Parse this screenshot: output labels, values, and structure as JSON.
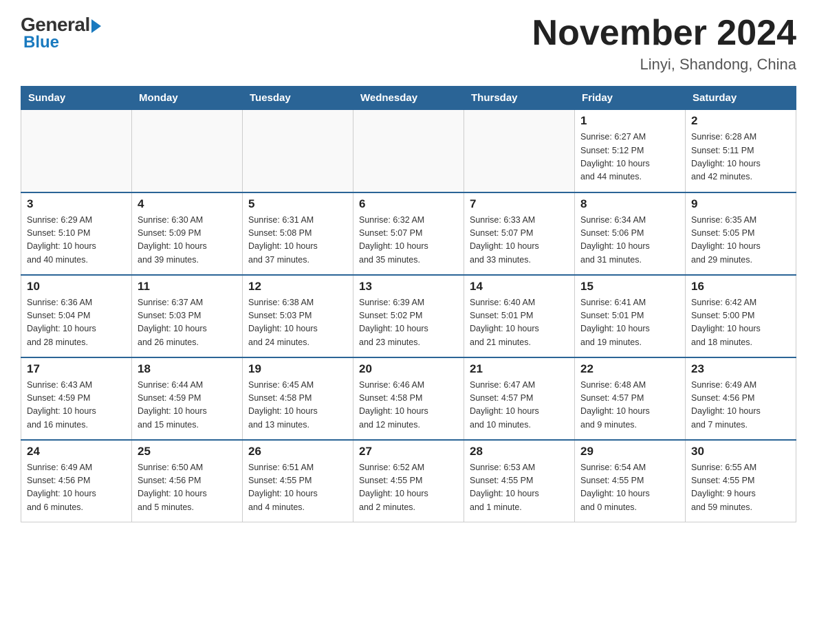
{
  "header": {
    "logo_general": "General",
    "logo_blue": "Blue",
    "title": "November 2024",
    "subtitle": "Linyi, Shandong, China"
  },
  "days_of_week": [
    "Sunday",
    "Monday",
    "Tuesday",
    "Wednesday",
    "Thursday",
    "Friday",
    "Saturday"
  ],
  "weeks": [
    [
      {
        "day": "",
        "info": ""
      },
      {
        "day": "",
        "info": ""
      },
      {
        "day": "",
        "info": ""
      },
      {
        "day": "",
        "info": ""
      },
      {
        "day": "",
        "info": ""
      },
      {
        "day": "1",
        "info": "Sunrise: 6:27 AM\nSunset: 5:12 PM\nDaylight: 10 hours\nand 44 minutes."
      },
      {
        "day": "2",
        "info": "Sunrise: 6:28 AM\nSunset: 5:11 PM\nDaylight: 10 hours\nand 42 minutes."
      }
    ],
    [
      {
        "day": "3",
        "info": "Sunrise: 6:29 AM\nSunset: 5:10 PM\nDaylight: 10 hours\nand 40 minutes."
      },
      {
        "day": "4",
        "info": "Sunrise: 6:30 AM\nSunset: 5:09 PM\nDaylight: 10 hours\nand 39 minutes."
      },
      {
        "day": "5",
        "info": "Sunrise: 6:31 AM\nSunset: 5:08 PM\nDaylight: 10 hours\nand 37 minutes."
      },
      {
        "day": "6",
        "info": "Sunrise: 6:32 AM\nSunset: 5:07 PM\nDaylight: 10 hours\nand 35 minutes."
      },
      {
        "day": "7",
        "info": "Sunrise: 6:33 AM\nSunset: 5:07 PM\nDaylight: 10 hours\nand 33 minutes."
      },
      {
        "day": "8",
        "info": "Sunrise: 6:34 AM\nSunset: 5:06 PM\nDaylight: 10 hours\nand 31 minutes."
      },
      {
        "day": "9",
        "info": "Sunrise: 6:35 AM\nSunset: 5:05 PM\nDaylight: 10 hours\nand 29 minutes."
      }
    ],
    [
      {
        "day": "10",
        "info": "Sunrise: 6:36 AM\nSunset: 5:04 PM\nDaylight: 10 hours\nand 28 minutes."
      },
      {
        "day": "11",
        "info": "Sunrise: 6:37 AM\nSunset: 5:03 PM\nDaylight: 10 hours\nand 26 minutes."
      },
      {
        "day": "12",
        "info": "Sunrise: 6:38 AM\nSunset: 5:03 PM\nDaylight: 10 hours\nand 24 minutes."
      },
      {
        "day": "13",
        "info": "Sunrise: 6:39 AM\nSunset: 5:02 PM\nDaylight: 10 hours\nand 23 minutes."
      },
      {
        "day": "14",
        "info": "Sunrise: 6:40 AM\nSunset: 5:01 PM\nDaylight: 10 hours\nand 21 minutes."
      },
      {
        "day": "15",
        "info": "Sunrise: 6:41 AM\nSunset: 5:01 PM\nDaylight: 10 hours\nand 19 minutes."
      },
      {
        "day": "16",
        "info": "Sunrise: 6:42 AM\nSunset: 5:00 PM\nDaylight: 10 hours\nand 18 minutes."
      }
    ],
    [
      {
        "day": "17",
        "info": "Sunrise: 6:43 AM\nSunset: 4:59 PM\nDaylight: 10 hours\nand 16 minutes."
      },
      {
        "day": "18",
        "info": "Sunrise: 6:44 AM\nSunset: 4:59 PM\nDaylight: 10 hours\nand 15 minutes."
      },
      {
        "day": "19",
        "info": "Sunrise: 6:45 AM\nSunset: 4:58 PM\nDaylight: 10 hours\nand 13 minutes."
      },
      {
        "day": "20",
        "info": "Sunrise: 6:46 AM\nSunset: 4:58 PM\nDaylight: 10 hours\nand 12 minutes."
      },
      {
        "day": "21",
        "info": "Sunrise: 6:47 AM\nSunset: 4:57 PM\nDaylight: 10 hours\nand 10 minutes."
      },
      {
        "day": "22",
        "info": "Sunrise: 6:48 AM\nSunset: 4:57 PM\nDaylight: 10 hours\nand 9 minutes."
      },
      {
        "day": "23",
        "info": "Sunrise: 6:49 AM\nSunset: 4:56 PM\nDaylight: 10 hours\nand 7 minutes."
      }
    ],
    [
      {
        "day": "24",
        "info": "Sunrise: 6:49 AM\nSunset: 4:56 PM\nDaylight: 10 hours\nand 6 minutes."
      },
      {
        "day": "25",
        "info": "Sunrise: 6:50 AM\nSunset: 4:56 PM\nDaylight: 10 hours\nand 5 minutes."
      },
      {
        "day": "26",
        "info": "Sunrise: 6:51 AM\nSunset: 4:55 PM\nDaylight: 10 hours\nand 4 minutes."
      },
      {
        "day": "27",
        "info": "Sunrise: 6:52 AM\nSunset: 4:55 PM\nDaylight: 10 hours\nand 2 minutes."
      },
      {
        "day": "28",
        "info": "Sunrise: 6:53 AM\nSunset: 4:55 PM\nDaylight: 10 hours\nand 1 minute."
      },
      {
        "day": "29",
        "info": "Sunrise: 6:54 AM\nSunset: 4:55 PM\nDaylight: 10 hours\nand 0 minutes."
      },
      {
        "day": "30",
        "info": "Sunrise: 6:55 AM\nSunset: 4:55 PM\nDaylight: 9 hours\nand 59 minutes."
      }
    ]
  ]
}
